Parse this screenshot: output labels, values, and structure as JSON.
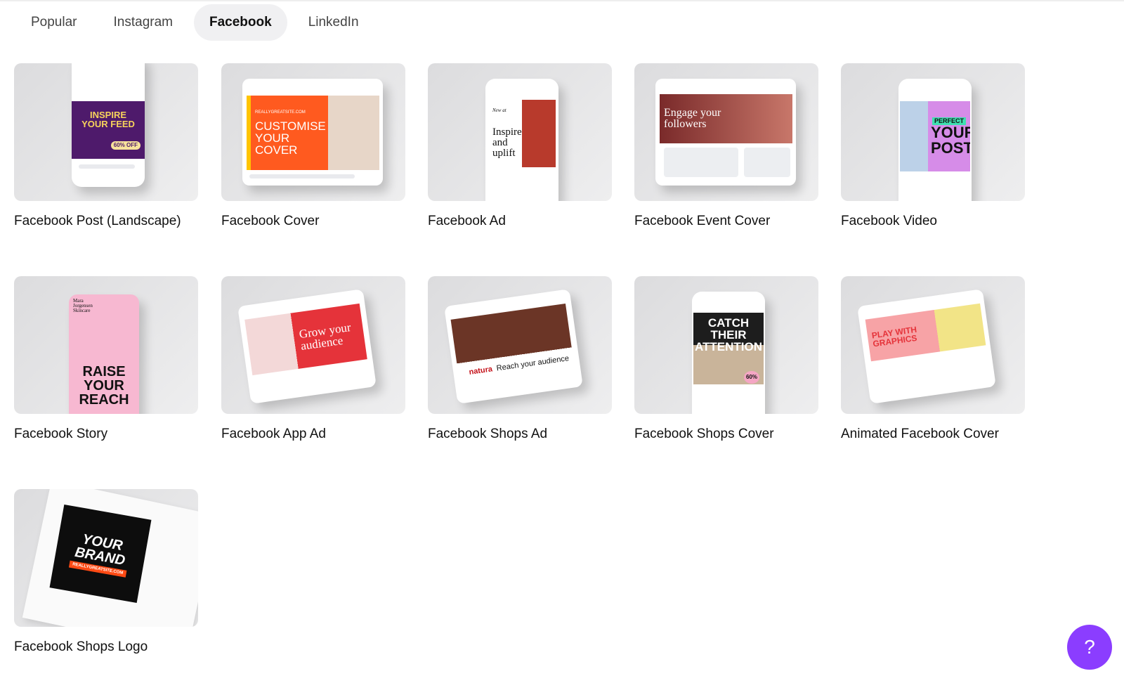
{
  "tabs": [
    {
      "label": "Popular"
    },
    {
      "label": "Instagram"
    },
    {
      "label": "Facebook",
      "active": true
    },
    {
      "label": "LinkedIn"
    }
  ],
  "templates": [
    {
      "label": "Facebook Post (Landscape)",
      "art": "INSPIRE YOUR FEED",
      "badge": "60% OFF"
    },
    {
      "label": "Facebook Cover",
      "site": "REALLYGREATSITE.COM",
      "art": "CUSTOMISE YOUR COVER"
    },
    {
      "label": "Facebook Ad",
      "small": "New at",
      "art": "Inspire and uplift"
    },
    {
      "label": "Facebook Event Cover",
      "art": "Engage your followers"
    },
    {
      "label": "Facebook Video",
      "small": "PERFECT",
      "art": "YOUR POST"
    },
    {
      "label": "Facebook Story",
      "small": "Mara Jorgensen Skincare",
      "art": "RAISE YOUR REACH"
    },
    {
      "label": "Facebook App Ad",
      "art": "Grow your audience"
    },
    {
      "label": "Facebook Shops Ad",
      "small": "natura",
      "art": "Reach your audience"
    },
    {
      "label": "Facebook Shops Cover",
      "art": "CATCH THEIR ATTENTION",
      "badge": "60%"
    },
    {
      "label": "Animated Facebook Cover",
      "art": "PLAY WITH GRAPHICS"
    },
    {
      "label": "Facebook Shops Logo",
      "art": "YOUR BRAND",
      "site": "REALLYGREATSITE.COM"
    }
  ],
  "help": {
    "label": "?"
  },
  "colors": {
    "accent": "#8b3dff",
    "active_tab_bg": "#f0f0f2"
  }
}
